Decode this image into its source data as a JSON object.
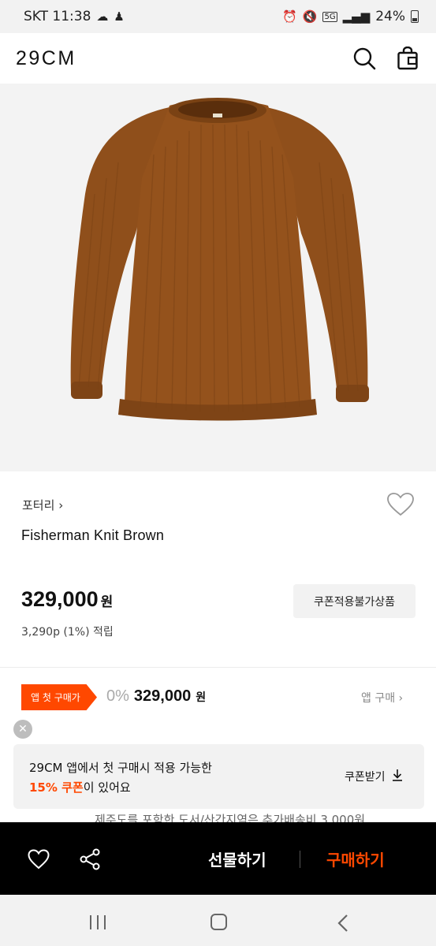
{
  "status_bar": {
    "carrier_time": "SKT 11:38",
    "network": "5G",
    "battery": "24%"
  },
  "header": {
    "logo": "29CM",
    "icons": [
      "search-icon",
      "shopping-bag-icon"
    ]
  },
  "product": {
    "image": "brown-knit-sweater",
    "brand": "포터리",
    "brand_chevron": "›",
    "name": "Fisherman Knit Brown",
    "price": "329,000",
    "currency": "원",
    "coupon_badge": "쿠폰적용불가상품",
    "points": "3,290p (1%) 적립"
  },
  "app_price": {
    "tag": "앱 첫 구매가",
    "rate": "0%",
    "price": "329,000",
    "currency": "원",
    "link": "앱 구매 ›"
  },
  "banner": {
    "line1": "29CM 앱에서 첫 구매시 적용 가능한",
    "highlight": "15% 쿠폰",
    "line2_rest": "이 있어요",
    "download": "쿠폰받기"
  },
  "shipping_note": "제주도를 포함한 도서/산간지역은 추가배송비 3,000원",
  "action_bar": {
    "gift": "선물하기",
    "buy": "구매하기",
    "buy_color": "#ff4800"
  },
  "colors": {
    "accent": "#ff4800",
    "sweater": "#94521c"
  }
}
